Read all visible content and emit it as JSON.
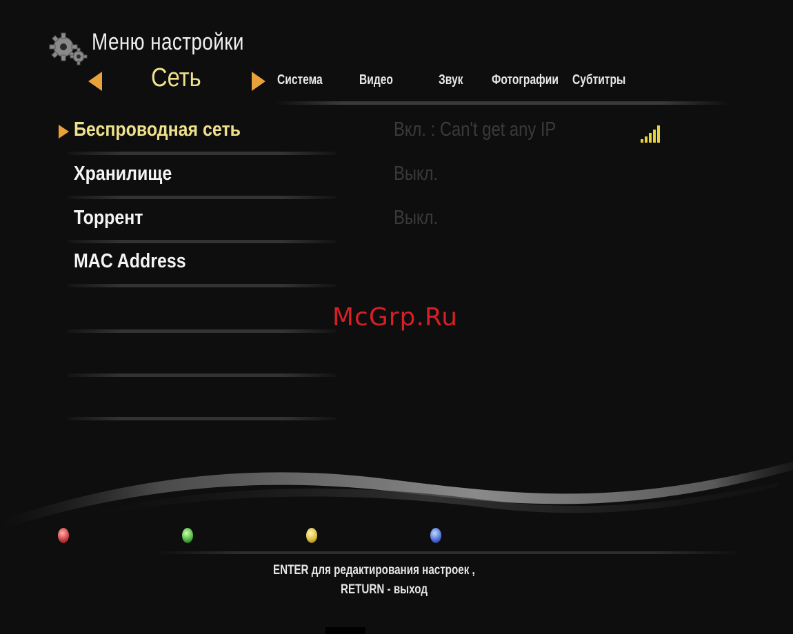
{
  "header": {
    "title": "Меню настройки",
    "icon": "gear-icon"
  },
  "tabs": {
    "active": "Сеть",
    "others": [
      "Система",
      "Видео",
      "Звук",
      "Фотографии",
      "Субтитры"
    ]
  },
  "settings": [
    {
      "label": "Беспроводная сеть",
      "value": "Вкл. : Can't get any IP",
      "selected": true
    },
    {
      "label": "Хранилище",
      "value": "Выкл."
    },
    {
      "label": "Торрент",
      "value": "Выкл."
    },
    {
      "label": "MAC Address",
      "value": ""
    }
  ],
  "watermark": "McGrp.Ru",
  "color_buttons": [
    "red",
    "green",
    "yellow",
    "blue"
  ],
  "footer": {
    "line1": "ENTER для редактирования настроек ,",
    "line2": "RETURN - выход"
  },
  "colors": {
    "accent": "#e9a23a",
    "selected_text": "#efe18c",
    "watermark": "#d81f26"
  }
}
